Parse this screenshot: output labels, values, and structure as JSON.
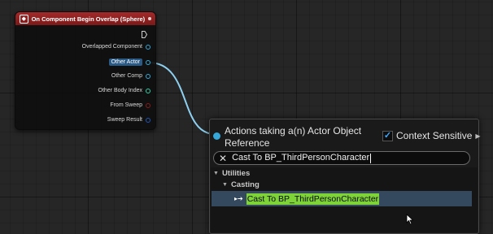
{
  "event_node": {
    "title": "On Component Begin Overlap (Sphere)",
    "pins": [
      {
        "label": "Overlapped Component",
        "color": "#35a7d9",
        "highlighted": false
      },
      {
        "label": "Other Actor",
        "color": "#35a7d9",
        "highlighted": true
      },
      {
        "label": "Other Comp",
        "color": "#35a7d9",
        "highlighted": false
      },
      {
        "label": "Other Body Index",
        "color": "#2ed3a6",
        "highlighted": false
      },
      {
        "label": "From Sweep",
        "color": "#8c1a1a",
        "highlighted": false
      },
      {
        "label": "Sweep Result",
        "color": "#1f56b8",
        "highlighted": false
      }
    ]
  },
  "action_menu": {
    "title": "Actions taking a(n) Actor Object Reference",
    "context_sensitive_label": "Context Sensitive",
    "context_sensitive_checked": true,
    "search_value": "Cast To BP_ThirdPersonCharacter",
    "categories": {
      "utilities": "Utilities",
      "casting": "Casting"
    },
    "selected_item": "Cast To BP_ThirdPersonCharacter"
  },
  "colors": {
    "object_pin": "#35a7d9",
    "event_header": "#a32a2a",
    "match_highlight": "#7ed339",
    "selected_row": "#34495e"
  },
  "icons": [
    "event-icon",
    "exec-pin-icon",
    "checkbox-icon",
    "clear-icon",
    "tree-triangle-icon",
    "cast-node-icon",
    "mouse-cursor-icon"
  ]
}
